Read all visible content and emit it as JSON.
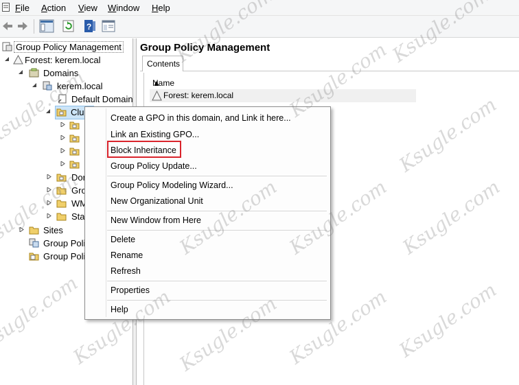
{
  "menubar": {
    "items": [
      "File",
      "Action",
      "View",
      "Window",
      "Help"
    ]
  },
  "toolbar": {
    "buttons": [
      "back-icon",
      "forward-icon",
      "show-hide-pane-icon",
      "refresh-icon",
      "help-icon",
      "properties-icon"
    ]
  },
  "tree": {
    "root": "Group Policy Management",
    "forest": "Forest: kerem.local",
    "domains": "Domains",
    "domain": "kerem.local",
    "default_policy": "Default Domain",
    "clu": "Clu",
    "dom": "Dor",
    "gro": "Gro",
    "wm": "WM",
    "sta": "Star",
    "sites": "Sites",
    "gp_modeling": "Group Poli",
    "gp_results": "Group Poli"
  },
  "right": {
    "title": "Group Policy Management",
    "tab_label": "Contents",
    "column_header": "Name",
    "row": "Forest: kerem.local"
  },
  "context_menu": {
    "items": [
      "Create a GPO in this domain, and Link it here...",
      "Link an Existing GPO...",
      "Block Inheritance",
      "Group Policy Update...",
      "Group Policy Modeling Wizard...",
      "New Organizational Unit",
      "New Window from Here",
      "Delete",
      "Rename",
      "Refresh",
      "Properties",
      "Help"
    ],
    "highlighted": "Block Inheritance",
    "highlight_color": "#d9232b"
  },
  "watermark": "Ksugle.com"
}
